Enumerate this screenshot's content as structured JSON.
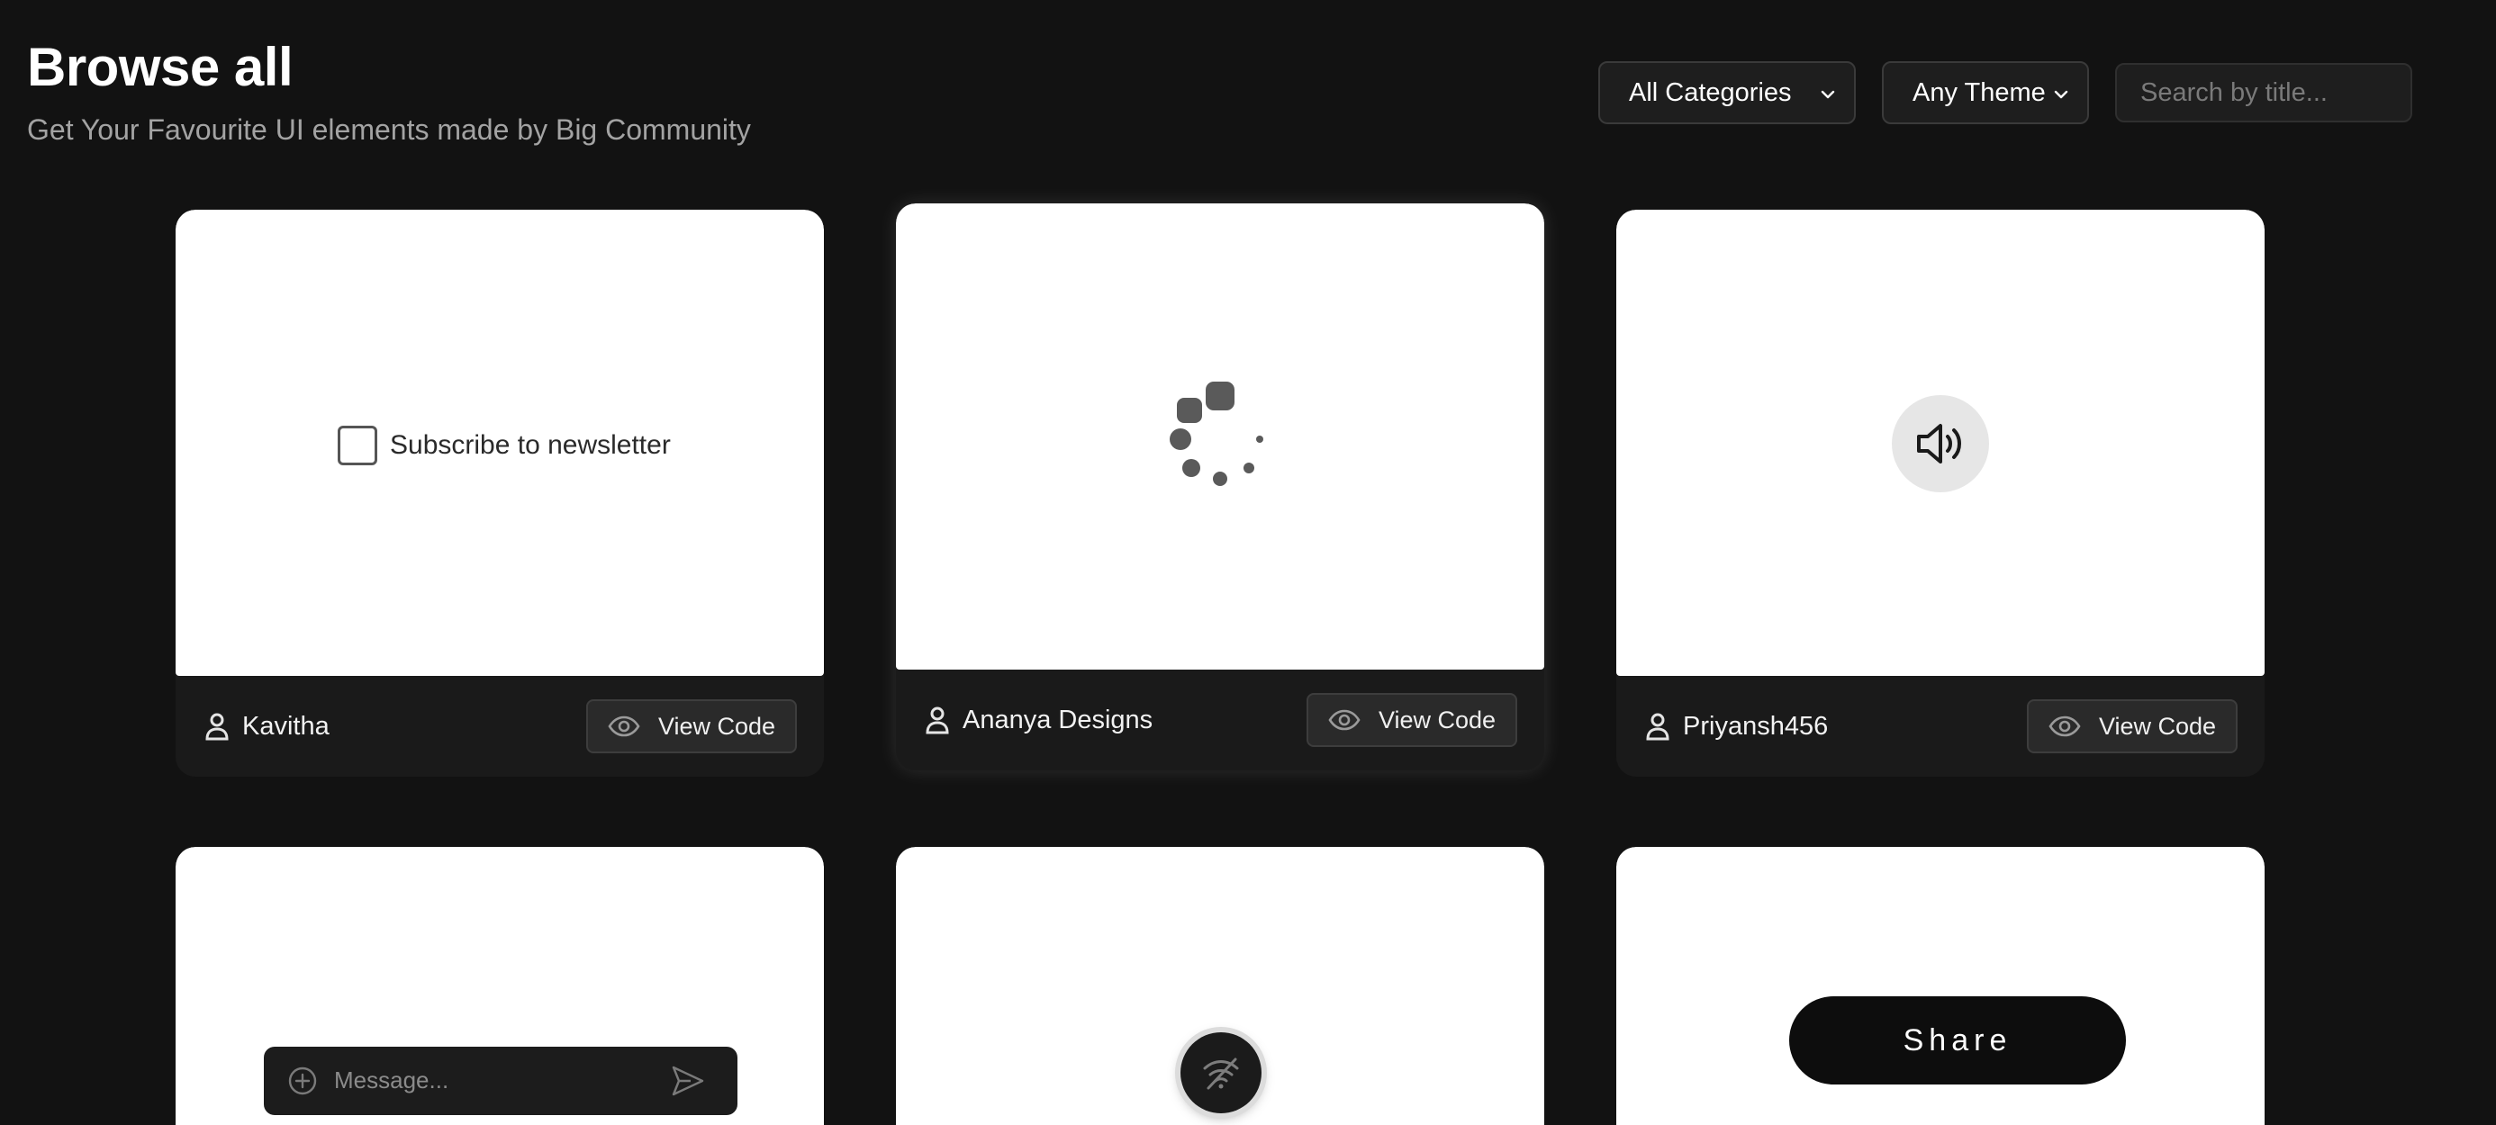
{
  "header": {
    "title": "Browse all",
    "subtitle": "Get Your Favourite UI elements made by Big Community"
  },
  "filters": {
    "category": {
      "selected": "All Categories"
    },
    "theme": {
      "selected": "Any Theme"
    },
    "search": {
      "placeholder": "Search by title..."
    }
  },
  "cards": [
    {
      "author": "Kavitha",
      "action": "View Code",
      "preview": {
        "type": "checkbox",
        "label": "Subscribe to newsletter",
        "checked": false
      }
    },
    {
      "author": "Ananya Designs",
      "action": "View Code",
      "preview": {
        "type": "loader",
        "icon": "dots-spinner-icon"
      }
    },
    {
      "author": "Priyansh456",
      "action": "View Code",
      "preview": {
        "type": "icon-button",
        "icon": "speaker-icon"
      }
    },
    {
      "preview": {
        "type": "message-input",
        "placeholder": "Message...",
        "icons": [
          "plus-circle-icon",
          "send-icon"
        ]
      }
    },
    {
      "preview": {
        "type": "toggle-button",
        "icon": "wifi-off-icon"
      }
    },
    {
      "preview": {
        "type": "button",
        "label": "Share"
      }
    }
  ],
  "colors": {
    "background": "#121212",
    "card_footer": "#1a1a1a",
    "preview_bg": "#ffffff",
    "button_bg": "#2a2a2a",
    "subtitle": "#a3a3a3"
  }
}
